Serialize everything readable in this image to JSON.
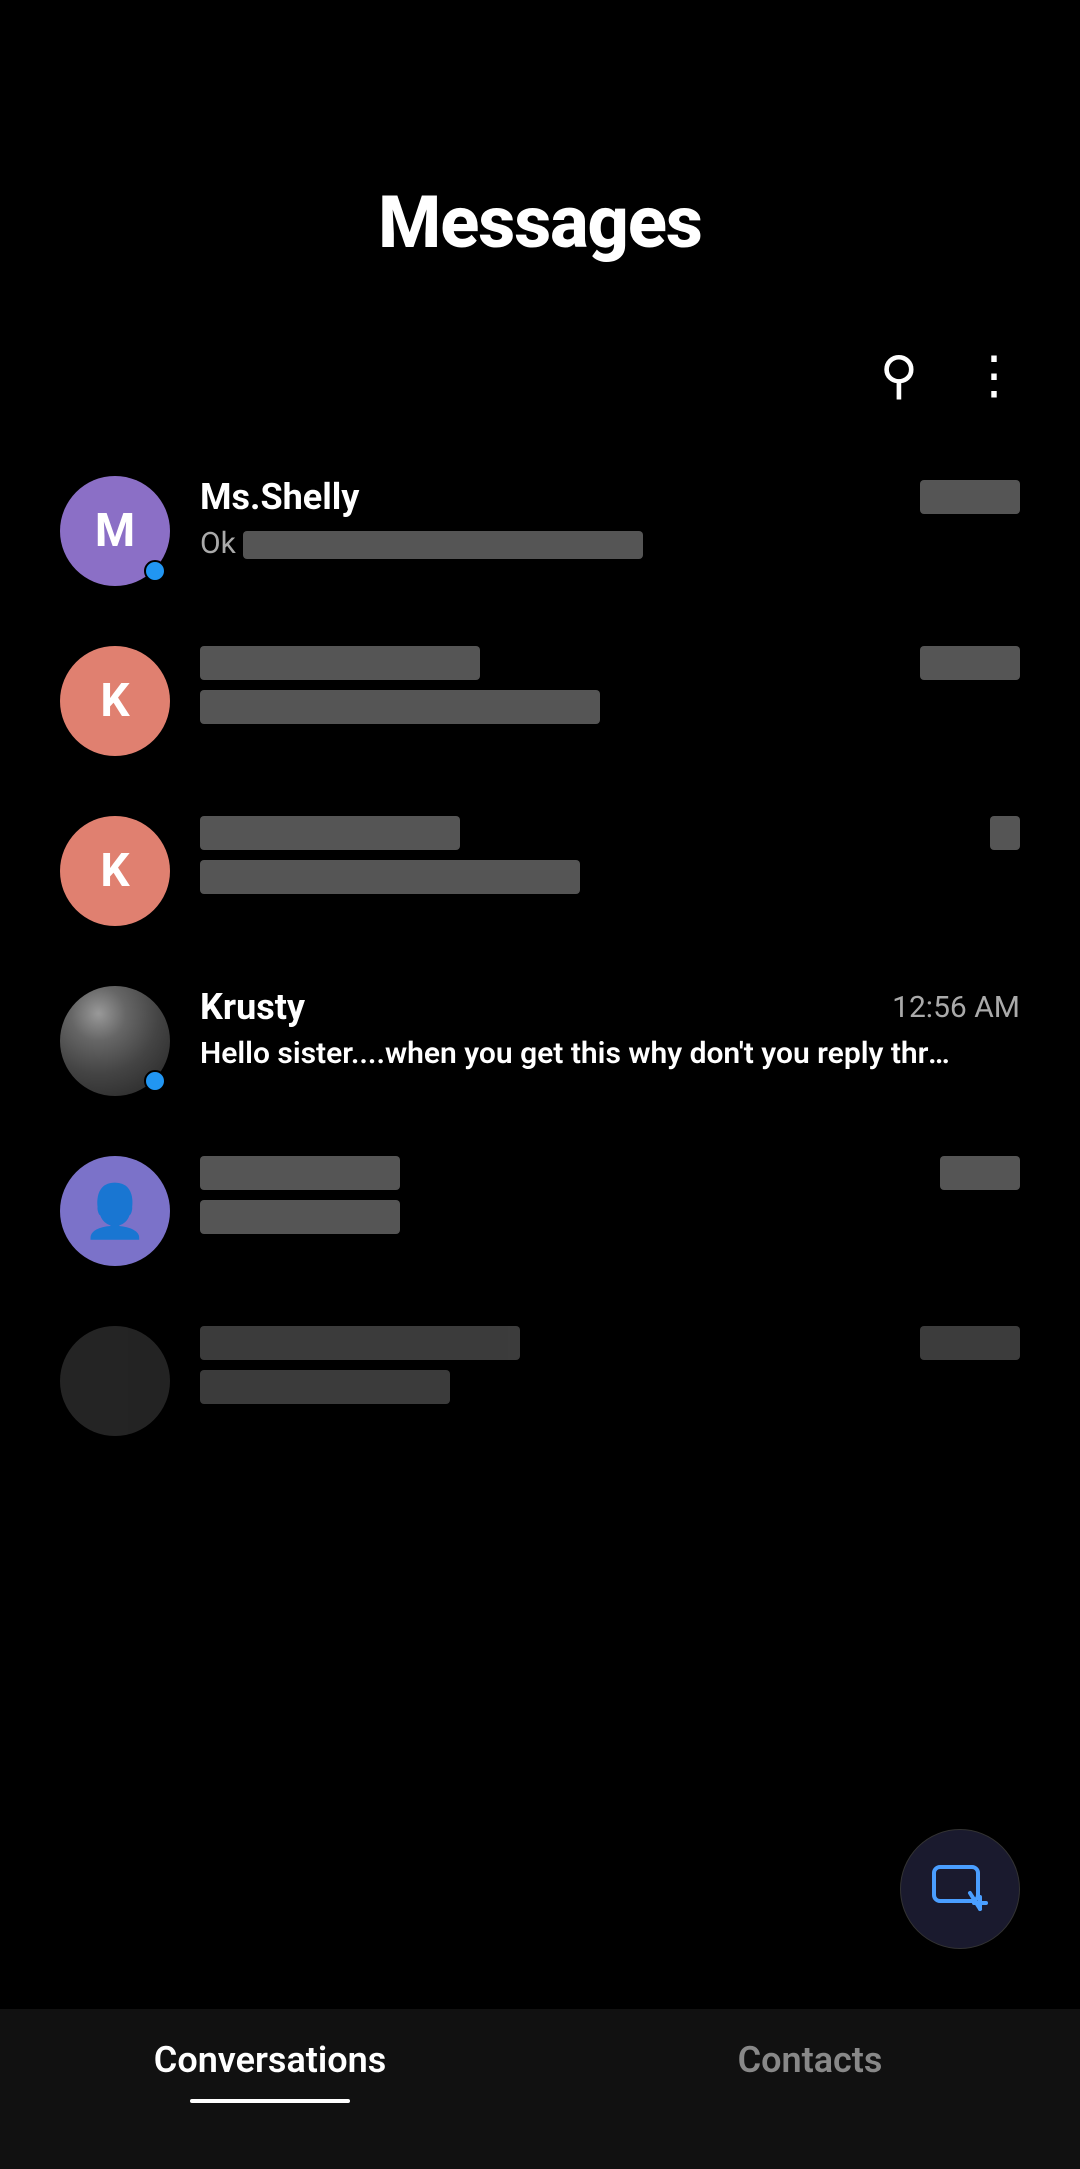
{
  "page": {
    "title": "Messages",
    "toolbar": {
      "search_icon": "⌕",
      "more_icon": "⋮"
    }
  },
  "conversations": [
    {
      "id": "conv-1",
      "name": "Ms.Shelly",
      "preview": "Ok",
      "time": "",
      "avatar_letter": "M",
      "avatar_color": "purple",
      "has_online": true,
      "name_redacted": false,
      "preview_redacted": false,
      "time_redacted": true
    },
    {
      "id": "conv-2",
      "name": "",
      "preview": "",
      "time": "",
      "avatar_letter": "K",
      "avatar_color": "salmon",
      "has_online": false,
      "name_redacted": true,
      "preview_redacted": true,
      "time_redacted": true
    },
    {
      "id": "conv-3",
      "name": "",
      "preview": "",
      "time": "",
      "avatar_letter": "K",
      "avatar_color": "salmon",
      "has_online": false,
      "name_redacted": true,
      "preview_redacted": true,
      "time_redacted": true
    },
    {
      "id": "conv-4",
      "name": "Krusty",
      "preview": "Hello sister....when you get this why don't you reply through here instead of yr Facebook acc...",
      "time": "12:56 AM",
      "avatar_letter": "",
      "avatar_color": "krusty",
      "has_online": true,
      "name_redacted": false,
      "preview_redacted": false,
      "time_redacted": false
    },
    {
      "id": "conv-5",
      "name": "",
      "preview": "",
      "time": "",
      "avatar_letter": "👤",
      "avatar_color": "lavender",
      "has_online": false,
      "name_redacted": true,
      "preview_redacted": false,
      "time_redacted": true
    },
    {
      "id": "conv-6",
      "name": "",
      "preview": "",
      "time": "",
      "avatar_letter": "",
      "avatar_color": "dark",
      "has_online": false,
      "name_redacted": true,
      "preview_redacted": false,
      "time_redacted": true
    }
  ],
  "bottom_nav": {
    "tabs": [
      {
        "label": "Conversations",
        "active": true
      },
      {
        "label": "Contacts",
        "active": false
      }
    ]
  },
  "fab": {
    "icon": "💬"
  }
}
